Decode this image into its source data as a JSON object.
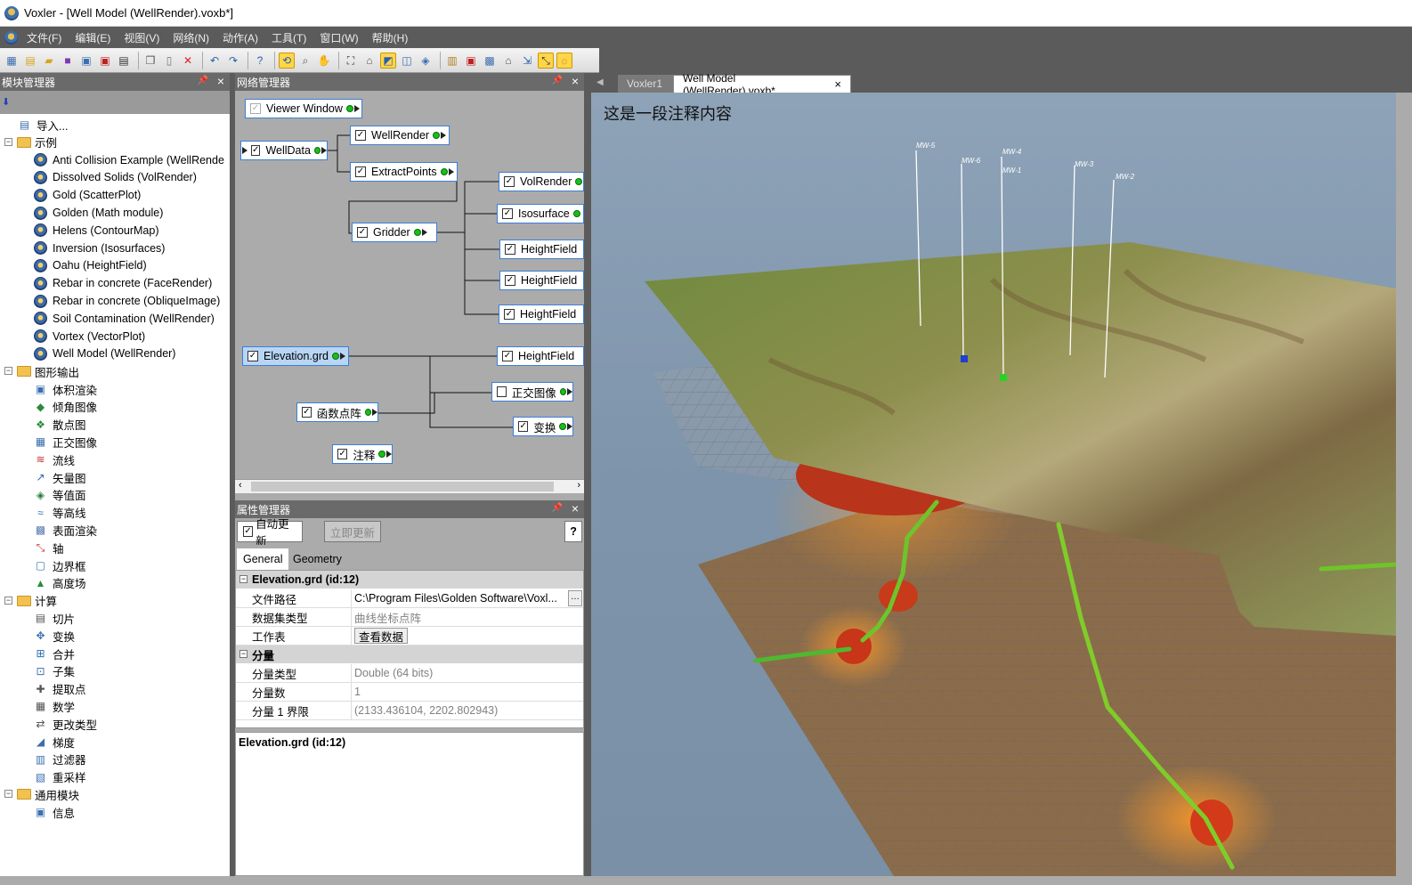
{
  "window": {
    "title": "Voxler - [Well Model (WellRender).voxb*]"
  },
  "menubar": {
    "items": [
      "文件(F)",
      "编辑(E)",
      "视图(V)",
      "网络(N)",
      "动作(A)",
      "工具(T)",
      "窗口(W)",
      "帮助(H)"
    ]
  },
  "module_manager": {
    "title": "模块管理器",
    "import_label": "导入...",
    "groups": [
      {
        "label": "示例",
        "items": [
          "Anti Collision Example (WellRende",
          "Dissolved Solids (VolRender)",
          "Gold (ScatterPlot)",
          "Golden (Math module)",
          "Helens (ContourMap)",
          "Inversion (Isosurfaces)",
          "Oahu (HeightField)",
          "Rebar in concrete (FaceRender)",
          "Rebar in concrete (ObliqueImage)",
          "Soil Contamination (WellRender)",
          "Vortex (VectorPlot)",
          "Well Model (WellRender)"
        ]
      },
      {
        "label": "图形输出",
        "items": [
          "体积渲染",
          "倾角图像",
          "散点图",
          "正交图像",
          "流线",
          "矢量图",
          "等值面",
          "等高线",
          "表面渲染",
          "轴",
          "边界框",
          "高度场"
        ]
      },
      {
        "label": "计算",
        "items": [
          "切片",
          "变换",
          "合并",
          "子集",
          "提取点",
          "数学",
          "更改类型",
          "梯度",
          "过滤器",
          "重采样"
        ]
      },
      {
        "label": "通用模块",
        "items": [
          "信息"
        ]
      }
    ]
  },
  "network_manager": {
    "title": "网络管理器",
    "modules": {
      "viewer_window": "Viewer Window",
      "welldata": "WellData",
      "wellrender": "WellRender",
      "extractpoints": "ExtractPoints",
      "gridder": "Gridder",
      "volrender": "VolRender",
      "isosurface": "Isosurface",
      "heightfield1": "HeightField",
      "heightfield2": "HeightField",
      "heightfield3": "HeightField",
      "elevation": "Elevation.grd",
      "heightfield4": "HeightField",
      "ortho_image": "正交图像",
      "function_lattice": "函数点阵",
      "transform": "变换",
      "annotation": "注释"
    }
  },
  "property_manager": {
    "title": "属性管理器",
    "auto_update_label": "自动更新",
    "update_now_label": "立即更新",
    "help_label": "?",
    "tabs": [
      "General",
      "Geometry"
    ],
    "category1": "Elevation.grd (id:12)",
    "rows1": [
      {
        "key": "文件路径",
        "value": "C:\\Program Files\\Golden Software\\Voxl..."
      },
      {
        "key": "数据集类型",
        "value": "曲线坐标点阵"
      },
      {
        "key": "工作表",
        "value": "查看数据"
      }
    ],
    "category2": "分量",
    "rows2": [
      {
        "key": "分量类型",
        "value": "Double (64 bits)"
      },
      {
        "key": "分量数",
        "value": "1"
      },
      {
        "key": "分量 1 界限",
        "value": "(2133.436104, 2202.802943)"
      }
    ],
    "description_title": "Elevation.grd (id:12)"
  },
  "documents": {
    "tabs": [
      "Voxler1",
      "Well Model (WellRender).voxb*"
    ],
    "close_glyph": "×"
  },
  "viewer": {
    "annotation": "这是一段注释内容",
    "well_labels": [
      "MW-5",
      "MW-6",
      "MW-4",
      "MW-1",
      "MW-3",
      "MW-2"
    ]
  },
  "colors": {
    "panel_dark": "#5b5b5b",
    "panel_mid": "#ababab",
    "module_border": "#3d7fd4",
    "port_green": "#18c018",
    "selection": "#b8d6f4"
  }
}
